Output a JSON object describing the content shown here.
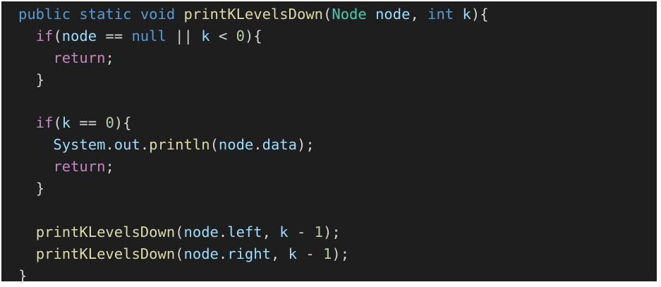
{
  "colors": {
    "background": "#1e1e1e",
    "keyword_blue": "#569cd6",
    "control_purple": "#c586c0",
    "function_yellow": "#dcdcaa",
    "type_teal": "#4ec9b0",
    "variable_blue": "#9cdcfe",
    "number_green": "#b5cea8",
    "punctuation": "#d4d4d4"
  },
  "code": {
    "language": "java",
    "lines": [
      {
        "indent": "",
        "tokens": [
          {
            "text": "public",
            "kind": "keyword_blue"
          },
          {
            "text": " ",
            "kind": "punctuation"
          },
          {
            "text": "static",
            "kind": "keyword_blue"
          },
          {
            "text": " ",
            "kind": "punctuation"
          },
          {
            "text": "void",
            "kind": "keyword_blue"
          },
          {
            "text": " ",
            "kind": "punctuation"
          },
          {
            "text": "printKLevelsDown",
            "kind": "function_yellow"
          },
          {
            "text": "(",
            "kind": "punctuation"
          },
          {
            "text": "Node",
            "kind": "type_teal"
          },
          {
            "text": " ",
            "kind": "punctuation"
          },
          {
            "text": "node",
            "kind": "variable_blue"
          },
          {
            "text": ", ",
            "kind": "punctuation"
          },
          {
            "text": "int",
            "kind": "keyword_blue"
          },
          {
            "text": " ",
            "kind": "punctuation"
          },
          {
            "text": "k",
            "kind": "variable_blue"
          },
          {
            "text": "){",
            "kind": "punctuation"
          }
        ]
      },
      {
        "indent": "  ",
        "tokens": [
          {
            "text": "if",
            "kind": "control_purple"
          },
          {
            "text": "(",
            "kind": "punctuation"
          },
          {
            "text": "node",
            "kind": "variable_blue"
          },
          {
            "text": " == ",
            "kind": "punctuation"
          },
          {
            "text": "null",
            "kind": "keyword_blue"
          },
          {
            "text": " || ",
            "kind": "punctuation"
          },
          {
            "text": "k",
            "kind": "variable_blue"
          },
          {
            "text": " < ",
            "kind": "punctuation"
          },
          {
            "text": "0",
            "kind": "number_green"
          },
          {
            "text": "){",
            "kind": "punctuation"
          }
        ]
      },
      {
        "indent": "    ",
        "tokens": [
          {
            "text": "return",
            "kind": "control_purple"
          },
          {
            "text": ";",
            "kind": "punctuation"
          }
        ]
      },
      {
        "indent": "  ",
        "tokens": [
          {
            "text": "}",
            "kind": "punctuation"
          }
        ]
      },
      {
        "indent": "",
        "tokens": []
      },
      {
        "indent": "  ",
        "tokens": [
          {
            "text": "if",
            "kind": "control_purple"
          },
          {
            "text": "(",
            "kind": "punctuation"
          },
          {
            "text": "k",
            "kind": "variable_blue"
          },
          {
            "text": " == ",
            "kind": "punctuation"
          },
          {
            "text": "0",
            "kind": "number_green"
          },
          {
            "text": "){",
            "kind": "punctuation"
          }
        ]
      },
      {
        "indent": "    ",
        "tokens": [
          {
            "text": "System",
            "kind": "variable_blue"
          },
          {
            "text": ".",
            "kind": "punctuation"
          },
          {
            "text": "out",
            "kind": "variable_blue"
          },
          {
            "text": ".",
            "kind": "punctuation"
          },
          {
            "text": "println",
            "kind": "function_yellow"
          },
          {
            "text": "(",
            "kind": "punctuation"
          },
          {
            "text": "node",
            "kind": "variable_blue"
          },
          {
            "text": ".",
            "kind": "punctuation"
          },
          {
            "text": "data",
            "kind": "variable_blue"
          },
          {
            "text": ");",
            "kind": "punctuation"
          }
        ]
      },
      {
        "indent": "    ",
        "tokens": [
          {
            "text": "return",
            "kind": "control_purple"
          },
          {
            "text": ";",
            "kind": "punctuation"
          }
        ]
      },
      {
        "indent": "  ",
        "tokens": [
          {
            "text": "}",
            "kind": "punctuation"
          }
        ]
      },
      {
        "indent": "",
        "tokens": []
      },
      {
        "indent": "  ",
        "tokens": [
          {
            "text": "printKLevelsDown",
            "kind": "function_yellow"
          },
          {
            "text": "(",
            "kind": "punctuation"
          },
          {
            "text": "node",
            "kind": "variable_blue"
          },
          {
            "text": ".",
            "kind": "punctuation"
          },
          {
            "text": "left",
            "kind": "variable_blue"
          },
          {
            "text": ", ",
            "kind": "punctuation"
          },
          {
            "text": "k",
            "kind": "variable_blue"
          },
          {
            "text": " - ",
            "kind": "punctuation"
          },
          {
            "text": "1",
            "kind": "number_green"
          },
          {
            "text": ");",
            "kind": "punctuation"
          }
        ]
      },
      {
        "indent": "  ",
        "tokens": [
          {
            "text": "printKLevelsDown",
            "kind": "function_yellow"
          },
          {
            "text": "(",
            "kind": "punctuation"
          },
          {
            "text": "node",
            "kind": "variable_blue"
          },
          {
            "text": ".",
            "kind": "punctuation"
          },
          {
            "text": "right",
            "kind": "variable_blue"
          },
          {
            "text": ", ",
            "kind": "punctuation"
          },
          {
            "text": "k",
            "kind": "variable_blue"
          },
          {
            "text": " - ",
            "kind": "punctuation"
          },
          {
            "text": "1",
            "kind": "number_green"
          },
          {
            "text": ");",
            "kind": "punctuation"
          }
        ]
      },
      {
        "indent": "",
        "tokens": [
          {
            "text": "}",
            "kind": "punctuation"
          }
        ]
      }
    ]
  }
}
